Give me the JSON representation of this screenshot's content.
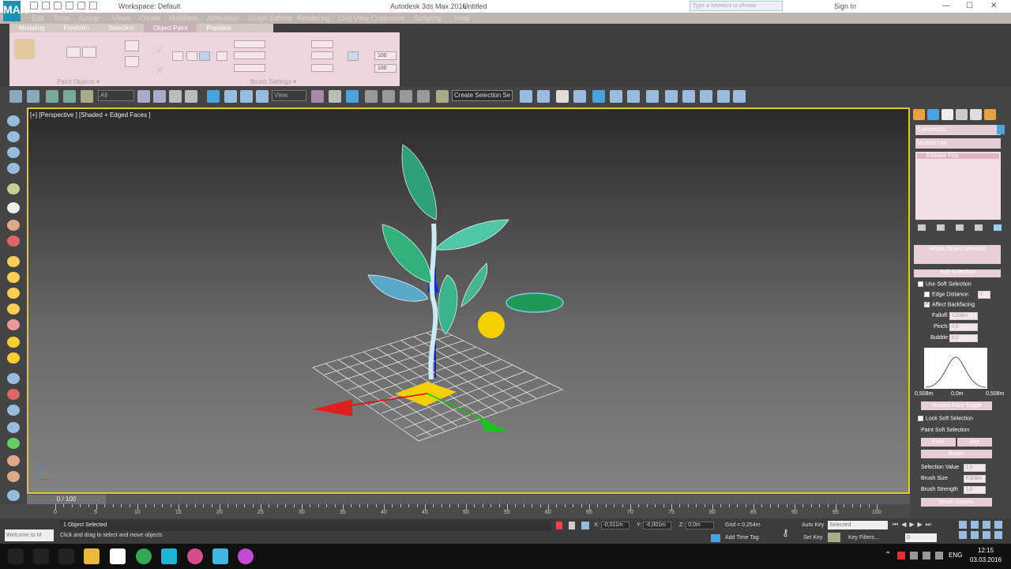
{
  "titlebar": {
    "logo": "MAX",
    "workspace": "Workspace: Default",
    "app_title": "Autodesk 3ds Max 2016",
    "document": "Untitled",
    "search_placeholder": "Type a keyword or phrase",
    "sign_in": "Sign In",
    "minimize": "—",
    "maximize": "☐",
    "close": "✕"
  },
  "menubar": [
    "Edit",
    "Tools",
    "Group",
    "Views",
    "Create",
    "Modifiers",
    "Animation",
    "Graph Editors",
    "Rendering",
    "Civil View",
    "Customize",
    "Scripting",
    "Help"
  ],
  "ribbon": {
    "tabs": [
      "Modeling",
      "Freeform",
      "Selection",
      "Object Paint",
      "Populate"
    ],
    "active_tab": 3,
    "panel_paint_objects": "Paint Objects ▾",
    "panel_brush_settings": "Brush Settings ▾",
    "spinner_values": [
      "100",
      "100"
    ]
  },
  "maintoolbar": {
    "selection_filter": "All",
    "ref_coord": "View",
    "create_selection_set": "Create Selection Se"
  },
  "viewport": {
    "label": "[+] [Perspective ] [Shaded + Edged Faces ]"
  },
  "cmdpanel": {
    "object_name": "Cylinder001",
    "modifier_list": "Modifier List",
    "stack_item": "Editable Poly",
    "sub_label": "Whole Object Selected",
    "soft_selection_header": "Soft Selection",
    "use_soft_selection": "Use Soft Selection",
    "edge_distance": "Edge Distance:",
    "edge_distance_value": "1",
    "affect_backfacing": "Affect Backfacing",
    "falloff": "Falloff:",
    "falloff_value": "0,508m",
    "pinch": "Pinch:",
    "pinch_value": "0,0",
    "bubble": "Bubble:",
    "bubble_value": "0,0",
    "curve_left": "0,508m",
    "curve_mid": "0,0m",
    "curve_right": "0,508m",
    "shaded_face_toggle": "Shaded Face Toggle",
    "lock_soft_selection": "Lock Soft Selection",
    "paint_soft_selection": "Paint Soft Selection",
    "paint": "Paint",
    "blur": "Blur",
    "revert": "Revert",
    "selection_value": "Selection Value",
    "selection_value_num": "1,0",
    "brush_size": "Brush Size",
    "brush_size_num": "0,508m",
    "brush_strength": "Brush Strength",
    "brush_strength_num": "1,0",
    "brush_options": "Brush Options"
  },
  "timeline": {
    "slider": "0 / 100",
    "labels": [
      "0",
      "5",
      "10",
      "15",
      "20",
      "25",
      "30",
      "35",
      "40",
      "45",
      "50",
      "55",
      "60",
      "65",
      "70",
      "75",
      "80",
      "85",
      "90",
      "95",
      "100"
    ]
  },
  "status": {
    "maxscript": "Welcome to M",
    "selection": "1 Object Selected",
    "prompt": "Click and drag to select and move objects",
    "x_label": "X:",
    "x_value": "-0,011m",
    "y_label": "Y:",
    "y_value": "-0,001m",
    "z_label": "Z:",
    "z_value": "0,0m",
    "grid": "Grid = 0,254m",
    "add_time_tag": "Add Time Tag",
    "auto_key": "Auto Key",
    "selected": "Selected",
    "set_key": "Set Key",
    "key_filters": "Key Filters...",
    "frame": "0"
  },
  "taskbar": {
    "lang": "ENG",
    "time": "12:15",
    "date": "03.03.2016"
  }
}
